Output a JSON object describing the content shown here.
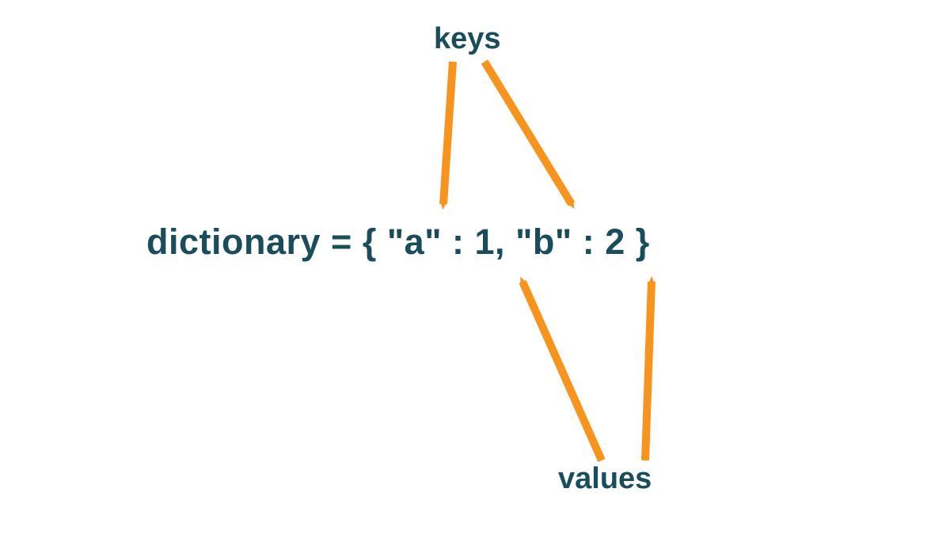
{
  "diagram": {
    "top_label": "keys",
    "bottom_label": "values",
    "code_expression": "dictionary = { \"a\" : 1, \"b\" : 2 }",
    "colors": {
      "text": "#1a4d5c",
      "arrow": "#f7941d"
    },
    "annotations": {
      "keys_point_to": [
        "\"a\"",
        "\"b\""
      ],
      "values_point_to": [
        "1",
        "2"
      ]
    }
  }
}
